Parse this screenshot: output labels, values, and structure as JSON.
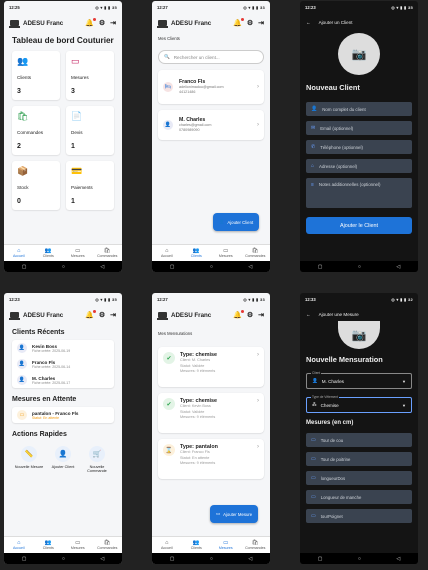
{
  "app_title": "ADESU Franc",
  "phone1": {
    "time": "12:25",
    "status_icons": "◎ ▾ ▮ ▮ 35",
    "page_title": "Tableau de bord Couturier",
    "cards": [
      {
        "label": "Clients",
        "value": "3",
        "icon": "👥",
        "color": "#1e73d8"
      },
      {
        "label": "Mesures",
        "value": "3",
        "icon": "▭",
        "color": "#c2185b"
      },
      {
        "label": "Commandes",
        "value": "2",
        "icon": "🛍",
        "color": "#2e9e4f"
      },
      {
        "label": "Devis",
        "value": "1",
        "icon": "📄",
        "color": "#f39c12"
      },
      {
        "label": "Stock",
        "value": "0",
        "icon": "📦",
        "color": "#c2185b"
      },
      {
        "label": "Paiements",
        "value": "1",
        "icon": "💳",
        "color": "#1e73d8"
      }
    ]
  },
  "nav": {
    "items": [
      "Accueil",
      "Clients",
      "Mesures",
      "Commandes"
    ],
    "icons": [
      "⌂",
      "👥",
      "▭",
      "🛍"
    ]
  },
  "sysnav": {
    "square": "▢",
    "circle": "○",
    "back": "◁"
  },
  "phone2": {
    "time": "12:27",
    "status_icons": "◎ ▾ ▮ ▮ 33",
    "section": "Mes Clients",
    "search_placeholder": "Rechercher un client...",
    "clients": [
      {
        "name": "Franco Fls",
        "email": "adelionimadou@gmail.com",
        "phone": "44121486"
      },
      {
        "name": "M. Charles",
        "email": "charles@gmail.com",
        "phone": "0780989090"
      }
    ],
    "fab_label": "Ajouter Client"
  },
  "phone3": {
    "time": "12:23",
    "status_icons": "◎ ▾ ▮ ▮ 35",
    "header": "Ajouter un Client",
    "title": "Nouveau Client",
    "fields": [
      {
        "label": "Nom complet du client",
        "icon": "👤"
      },
      {
        "label": "Email (optionnel)",
        "icon": "✉"
      },
      {
        "label": "Téléphone (optionnel)",
        "icon": "✆"
      },
      {
        "label": "Adresse (optionnel)",
        "icon": "⌂"
      },
      {
        "label": "Notes additionnelles (optionnel)",
        "icon": "≡"
      }
    ],
    "button": "Ajouter le Client"
  },
  "phone4": {
    "time": "12:23",
    "status_icons": "◎ ▾ ▮ ▮ 35",
    "recent_title": "Clients Récents",
    "recent": [
      {
        "name": "Kevin Boss",
        "sub": "Fiche créée: 2025-06-19"
      },
      {
        "name": "Franco Fls",
        "sub": "Fiche créée: 2025-06-14"
      },
      {
        "name": "M. Charles",
        "sub": "Fiche créée: 2025-06-17"
      }
    ],
    "pending_title": "Mesures en Attente",
    "pending": {
      "name": "pantalon - Franco Fls",
      "status": "Statut: En attente"
    },
    "quick_title": "Actions Rapides",
    "quick": [
      {
        "label": "Nouvelle Mesure",
        "icon": "📏"
      },
      {
        "label": "Ajouter Client",
        "icon": "👤"
      },
      {
        "label": "Nouvelle Commande",
        "icon": "🛒"
      }
    ]
  },
  "phone5": {
    "time": "12:27",
    "status_icons": "◎ ▾ ▮ ▮ 33",
    "section": "Mes Mensurations",
    "items": [
      {
        "type": "Type: chemise",
        "client": "Client: M. Charles",
        "status": "Statut: Validée",
        "note": "Mesures: 9 éléments",
        "state": "ok"
      },
      {
        "type": "Type: chemise",
        "client": "Client: Kevin Boss",
        "status": "Statut: Validée",
        "note": "Mesures: 9 éléments",
        "state": "ok"
      },
      {
        "type": "Type: pantalon",
        "client": "Client: Franco Fls",
        "status": "Statut: En attente",
        "note": "Mesures: 9 éléments",
        "state": "wait"
      }
    ],
    "fab_label": "Ajouter Mesure"
  },
  "phone6": {
    "time": "12:33",
    "status_icons": "◎ ▾ ▮ ▮ 32",
    "header": "Ajouter une Mesure",
    "title": "Nouvelle Mensuration",
    "client_label": "Client",
    "client_value": "M. Charles",
    "type_label": "Type de Vêtement",
    "type_value": "Chemise",
    "measures_title": "Mesures (en cm)",
    "fields": [
      "Tour de cou",
      "Tour de poitrine",
      "longueurDos",
      "Longueur de manche",
      "tourPoignet"
    ]
  }
}
